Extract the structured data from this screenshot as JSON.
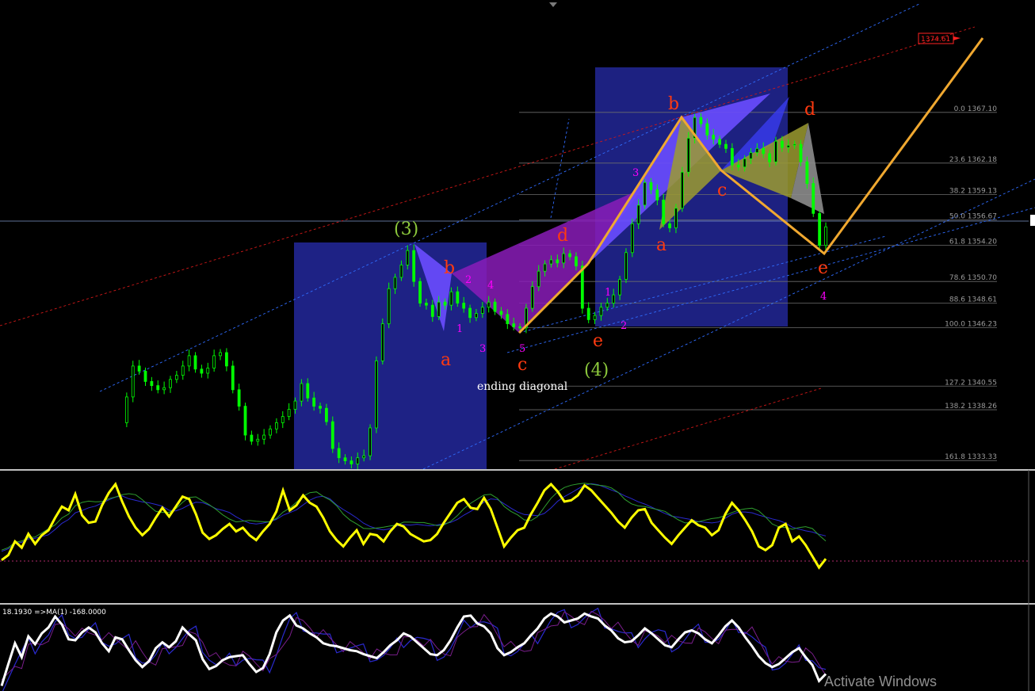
{
  "window": {
    "title": ""
  },
  "colors": {
    "background": "#000000",
    "candles": "#00ff00",
    "zones": "#20248c",
    "pattern_blue": "#6a4cff",
    "pattern_purple": "#8a1cb8",
    "pattern_yellow": "#9c9b30",
    "pattern_gray": "#8c8c8c",
    "zigzag": "#f0a830",
    "fib_lines": "#7a7a7a",
    "channel_blue": "#2f6cff",
    "channel_red": "#d01818",
    "oscillator1": "#ffff00",
    "oscillator2": "#ffffff",
    "wave_orange": "#ff3a10",
    "wave_green": "#8cc83c",
    "subwave_magenta": "#ff00ff"
  },
  "chart_data": {
    "type": "candlestick",
    "price_ylim": [
      1332.5,
      1378
    ],
    "fib_levels": [
      {
        "label": "0.0 1367.10",
        "price": 1367.1
      },
      {
        "label": "23.6 1362.18",
        "price": 1362.18
      },
      {
        "label": "38.2 1359.13",
        "price": 1359.13
      },
      {
        "label": "50.0 1356.67",
        "price": 1356.67
      },
      {
        "label": "61.8 1354.20",
        "price": 1354.2
      },
      {
        "label": "78.6 1350.70",
        "price": 1350.7
      },
      {
        "label": "88.6 1348.61",
        "price": 1348.61
      },
      {
        "label": "100.0 1346.23",
        "price": 1346.23
      },
      {
        "label": "127.2 1340.55",
        "price": 1340.55
      },
      {
        "label": "138.2 1338.26",
        "price": 1338.26
      },
      {
        "label": "161.8 1333.33",
        "price": 1333.33
      }
    ],
    "target_price_label": "1374.61",
    "target_price": 1374.61,
    "close_series": [
      1337.0,
      1339.5,
      1342.5,
      1342.0,
      1341.0,
      1340.6,
      1340.2,
      1340.4,
      1341.2,
      1341.6,
      1342.5,
      1343.5,
      1342.2,
      1341.8,
      1342.3,
      1343.5,
      1343.8,
      1342.5,
      1340.2,
      1338.6,
      1335.8,
      1335.2,
      1335.4,
      1335.8,
      1336.4,
      1337.0,
      1337.6,
      1338.3,
      1339.1,
      1340.8,
      1339.4,
      1338.6,
      1338.4,
      1337.1,
      1334.5,
      1333.6,
      1333.3,
      1333.0,
      1333.6,
      1333.8,
      1336.5,
      1343.0,
      1346.6,
      1350.0,
      1351.1,
      1352.3,
      1353.7,
      1350.7,
      1348.6,
      1348.4,
      1347.3,
      1348.7,
      1348.4,
      1349.7,
      1348.6,
      1348.1,
      1347.2,
      1347.6,
      1348.2,
      1348.7,
      1347.8,
      1347.5,
      1346.6,
      1346.3,
      1346.2,
      1348.1,
      1350.2,
      1351.7,
      1352.4,
      1352.8,
      1352.5,
      1353.4,
      1353.1,
      1352.2,
      1348.1,
      1347.0,
      1347.4,
      1348.2,
      1348.6,
      1349.4,
      1350.9,
      1353.5,
      1356.3,
      1358.1,
      1360.3,
      1359.6,
      1358.6,
      1356.3,
      1355.9,
      1357.8,
      1361.3,
      1364.6,
      1366.6,
      1366.0,
      1364.9,
      1364.5,
      1364.0,
      1363.6,
      1362.0,
      1361.8,
      1362.6,
      1363.2,
      1363.6,
      1363.1,
      1362.3,
      1364.3,
      1363.7,
      1363.9,
      1364.0,
      1362.3,
      1360.2,
      1357.3,
      1354.2,
      1356.0
    ],
    "wave_labels_major": [
      "(3)",
      "(4)"
    ],
    "wave_labels_abcde_first": [
      "a",
      "b",
      "c",
      "d",
      "e"
    ],
    "wave_labels_abcde_second": [
      "a",
      "b",
      "c",
      "d",
      "e"
    ],
    "subwave_labels_first": [
      "1",
      "2",
      "3",
      "4",
      "5"
    ],
    "subwave_labels_second": [
      "1",
      "2",
      "3"
    ],
    "subwave_label_final": "4",
    "annotation": "ending diagonal",
    "oscillator1": {
      "ylim": [
        0,
        100
      ],
      "reference_level": 30,
      "values": [
        32,
        36,
        47,
        42,
        53,
        45,
        52,
        56,
        66,
        75,
        72,
        85,
        68,
        62,
        63,
        76,
        86,
        93,
        79,
        67,
        58,
        52,
        57,
        66,
        74,
        67,
        75,
        83,
        81,
        69,
        54,
        49,
        52,
        57,
        61,
        55,
        58,
        52,
        48,
        55,
        61,
        71,
        88,
        72,
        76,
        84,
        78,
        75,
        66,
        55,
        48,
        43,
        50,
        56,
        45,
        53,
        52,
        47,
        55,
        61,
        59,
        53,
        50,
        47,
        48,
        53,
        62,
        70,
        78,
        81,
        74,
        73,
        82,
        73,
        58,
        43,
        50,
        56,
        58,
        69,
        78,
        88,
        93,
        87,
        79,
        80,
        84,
        92,
        88,
        82,
        76,
        70,
        63,
        58,
        66,
        72,
        73,
        62,
        56,
        50,
        45,
        52,
        58,
        64,
        60,
        58,
        52,
        56,
        69,
        78,
        72,
        64,
        55,
        43,
        40,
        44,
        58,
        61,
        47,
        51,
        44,
        35,
        26,
        33
      ]
    },
    "oscillator2": {
      "label": "18.1930 =>MA(1) -168.0000",
      "ylim": [
        -100,
        100
      ],
      "values": [
        2,
        24,
        45,
        31,
        52,
        44,
        55,
        61,
        72,
        64,
        49,
        48,
        56,
        61,
        56,
        45,
        37,
        51,
        49,
        38,
        28,
        21,
        27,
        40,
        46,
        41,
        47,
        61,
        54,
        48,
        29,
        19,
        22,
        28,
        31,
        32,
        33,
        24,
        16,
        20,
        34,
        56,
        68,
        73,
        63,
        60,
        55,
        51,
        45,
        43,
        42,
        40,
        38,
        37,
        34,
        32,
        30,
        36,
        43,
        48,
        55,
        52,
        46,
        40,
        34,
        33,
        38,
        48,
        61,
        72,
        73,
        65,
        62,
        55,
        40,
        33,
        36,
        41,
        45,
        53,
        60,
        70,
        75,
        72,
        66,
        68,
        70,
        75,
        72,
        70,
        63,
        58,
        50,
        46,
        47,
        53,
        60,
        55,
        49,
        43,
        41,
        49,
        56,
        58,
        55,
        49,
        45,
        53,
        62,
        68,
        61,
        51,
        42,
        32,
        25,
        21,
        24,
        30,
        36,
        40,
        31,
        23,
        7,
        14
      ]
    }
  },
  "overlay": {
    "watermark": "Activate Windows"
  }
}
